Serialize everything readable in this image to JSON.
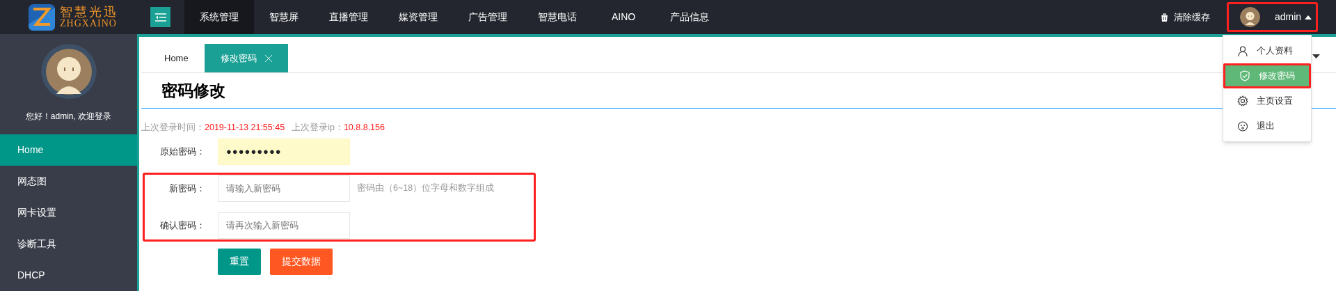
{
  "logo": {
    "title": "智慧光迅",
    "subtitle": "ZHGXAINO"
  },
  "nav": [
    {
      "label": "系统管理",
      "selected": true
    },
    {
      "label": "智慧屏",
      "selected": false
    },
    {
      "label": "直播管理",
      "selected": false
    },
    {
      "label": "媒资管理",
      "selected": false
    },
    {
      "label": "广告管理",
      "selected": false
    },
    {
      "label": "智慧电话",
      "selected": false
    },
    {
      "label": "AINO",
      "selected": false
    },
    {
      "label": "产品信息",
      "selected": false
    }
  ],
  "clear_cache": "清除缓存",
  "user_menu": {
    "name": "admin",
    "expanded": true,
    "highlighted": true,
    "items": [
      {
        "label": "个人资料",
        "kind": "person",
        "selected": false
      },
      {
        "label": "修改密码",
        "kind": "shield",
        "selected": true
      },
      {
        "label": "主页设置",
        "kind": "gear",
        "selected": false
      },
      {
        "label": "退出",
        "kind": "face",
        "selected": false
      }
    ]
  },
  "sidebar": {
    "greeting": "您好！admin, 欢迎登录",
    "items": [
      {
        "label": "Home",
        "selected": true
      },
      {
        "label": "网态图",
        "selected": false
      },
      {
        "label": "网卡设置",
        "selected": false
      },
      {
        "label": "诊断工具",
        "selected": false
      },
      {
        "label": "DHCP",
        "selected": false
      }
    ]
  },
  "tabs": [
    {
      "label": "Home",
      "selected": false,
      "closable": false
    },
    {
      "label": "修改密码",
      "selected": true,
      "closable": true
    }
  ],
  "page_title": "密码修改",
  "last_login": {
    "time_label": "上次登录时间：",
    "time": "2019-11-13 21:55:45",
    "ip_label": "上次登录ip：",
    "ip": "10.8.8.156"
  },
  "form": [
    {
      "label": "原始密码：",
      "value": "●●●●●●●●●",
      "autofill": true,
      "highlighted": false
    },
    {
      "label": "新密码：",
      "placeholder": "请输入新密码",
      "hint": "密码由（6~18）位字母和数字组成",
      "autofill": false,
      "highlighted": true
    },
    {
      "label": "确认密码：",
      "placeholder": "请再次输入新密码",
      "autofill": false,
      "highlighted": true
    }
  ],
  "buttons": [
    {
      "label": "重置",
      "kind": "reset"
    },
    {
      "label": "提交数据",
      "kind": "submit"
    }
  ]
}
